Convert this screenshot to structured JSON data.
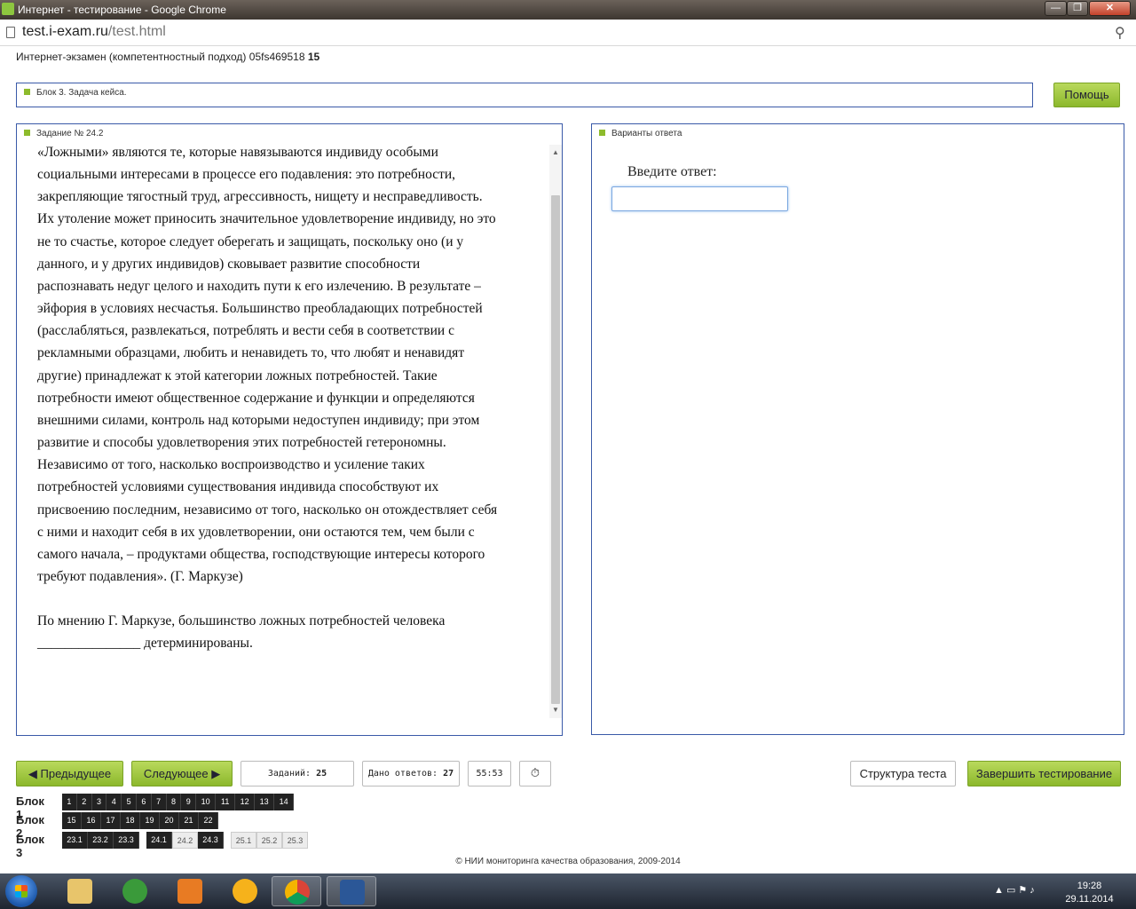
{
  "window": {
    "title": "Интернет - тестирование - Google Chrome",
    "minimize": "—",
    "maximize": "❐",
    "close": "✕"
  },
  "browser": {
    "url_host": "test.i-exam.ru",
    "url_path": "/test.html"
  },
  "exam": {
    "title": "Интернет-экзамен (компетентностный подход) 05fs469518",
    "number": "15"
  },
  "block_bar": {
    "label": "Блок 3. Задача кейса."
  },
  "help_button": "Помощь",
  "task": {
    "label": "Задание № 24.2",
    "paragraphs": [
      "«Ложными» являются те, которые навязываются индивиду особыми социальными интересами в процессе его подавления: это потребности, закрепляющие тягостный труд, агрессивность, нищету и несправедливость. Их утоление может приносить значительное удовлетворение индивиду, но это не то счастье, которое следует оберегать и защищать, поскольку оно (и у данного, и у других индивидов) сковывает развитие способности распознавать недуг целого и находить пути к его излечению. В результате – эйфория в условиях несчастья. Большинство преобладающих потребностей (расслабляться, развлекаться, потреблять и вести себя в соответствии с рекламными образцами, любить и ненавидеть то, что любят и ненавидят другие) принадлежат к этой категории ложных потребностей. Такие потребности имеют общественное содержание и функции и определяются внешними силами, контроль над которыми недоступен индивиду; при этом развитие и способы удовлетворения этих потребностей гетерономны. Независимо от того, насколько воспроизводство и усиление таких потребностей условиями существования индивида способствуют их присвоению последним, независимо от того, насколько он отождествляет себя с ними и находит себя в их удовлетворении, они остаются тем, чем были с самого начала, – продуктами общества, господствующие интересы которого требуют подавления». (Г. Маркузе)",
      "По мнению Г. Маркузе, большинство ложных потребностей человека _______________ детерминированы."
    ]
  },
  "answer": {
    "label": "Варианты ответа",
    "prompt": "Введите ответ:",
    "value": ""
  },
  "controls": {
    "prev": "Предыдущее",
    "next": "Следующее",
    "tasks_label": "Заданий:",
    "tasks_count": "25",
    "answers_label": "Дано ответов:",
    "answers_count": "27",
    "timer": "55:53",
    "structure": "Структура теста",
    "finish": "Завершить тестирование"
  },
  "blocks": [
    {
      "label": "Блок 1",
      "groups": [
        [
          "1",
          "2",
          "3",
          "4",
          "5",
          "6",
          "7",
          "8",
          "9",
          "10",
          "11",
          "12",
          "13",
          "14"
        ]
      ]
    },
    {
      "label": "Блок 2",
      "groups": [
        [
          "15",
          "16",
          "17",
          "18",
          "19",
          "20",
          "21",
          "22"
        ]
      ]
    },
    {
      "label": "Блок 3",
      "groups": [
        [
          "23.1",
          "23.2",
          "23.3"
        ],
        [
          "24.1",
          "24.2",
          "24.3"
        ],
        [
          "25.1",
          "25.2",
          "25.3"
        ]
      ]
    }
  ],
  "footer": "© НИИ мониторинга качества образования, 2009-2014",
  "taskbar": {
    "time": "19:28",
    "date": "29.11.2014"
  }
}
